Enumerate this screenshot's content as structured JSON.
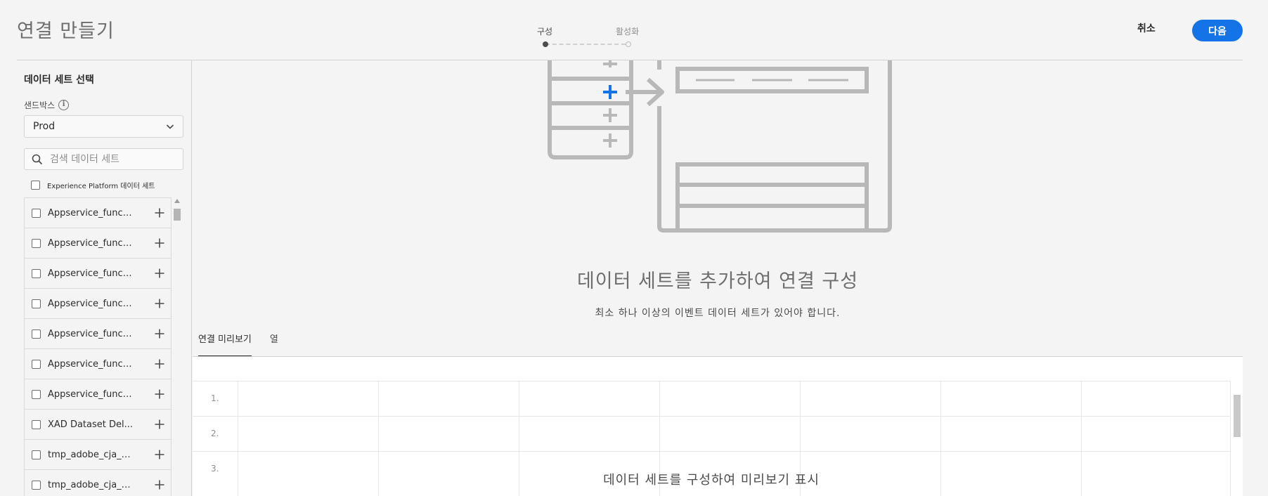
{
  "header": {
    "title": "연결 만들기",
    "steps": [
      {
        "label": "구성",
        "state": "current"
      },
      {
        "label": "활성화",
        "state": "upcoming"
      }
    ],
    "cancel_label": "취소",
    "next_label": "다음",
    "accent_color": "#1473e6"
  },
  "sidebar": {
    "title": "데이터 세트 선택",
    "sandbox_label": "샌드박스",
    "sandbox_value": "Prod",
    "search_placeholder": "검색 데이터 세트",
    "filter_label": "Experience Platform 데이터 세트",
    "datasets": [
      {
        "label": "Appservice_functi..."
      },
      {
        "label": "Appservice_functi..."
      },
      {
        "label": "Appservice_functi..."
      },
      {
        "label": "Appservice_functi..."
      },
      {
        "label": "Appservice_functi..."
      },
      {
        "label": "Appservice_functi..."
      },
      {
        "label": "Appservice_functi..."
      },
      {
        "label": "XAD Dataset Del..."
      },
      {
        "label": "tmp_adobe_cja_di..."
      },
      {
        "label": "tmp_adobe_cja_di..."
      }
    ]
  },
  "main": {
    "empty_title": "데이터 세트를 추가하여 연결 구성",
    "empty_subtitle": "최소 하나 이상의 이벤트 데이터 세트가 있어야 합니다.",
    "tabs": [
      {
        "label": "연결 미리보기",
        "active": true
      },
      {
        "label": "열",
        "active": false
      }
    ],
    "grid_rows": [
      "1.",
      "2.",
      "3."
    ],
    "grid_message": "데이터 세트를 구성하여 미리보기 표시"
  }
}
